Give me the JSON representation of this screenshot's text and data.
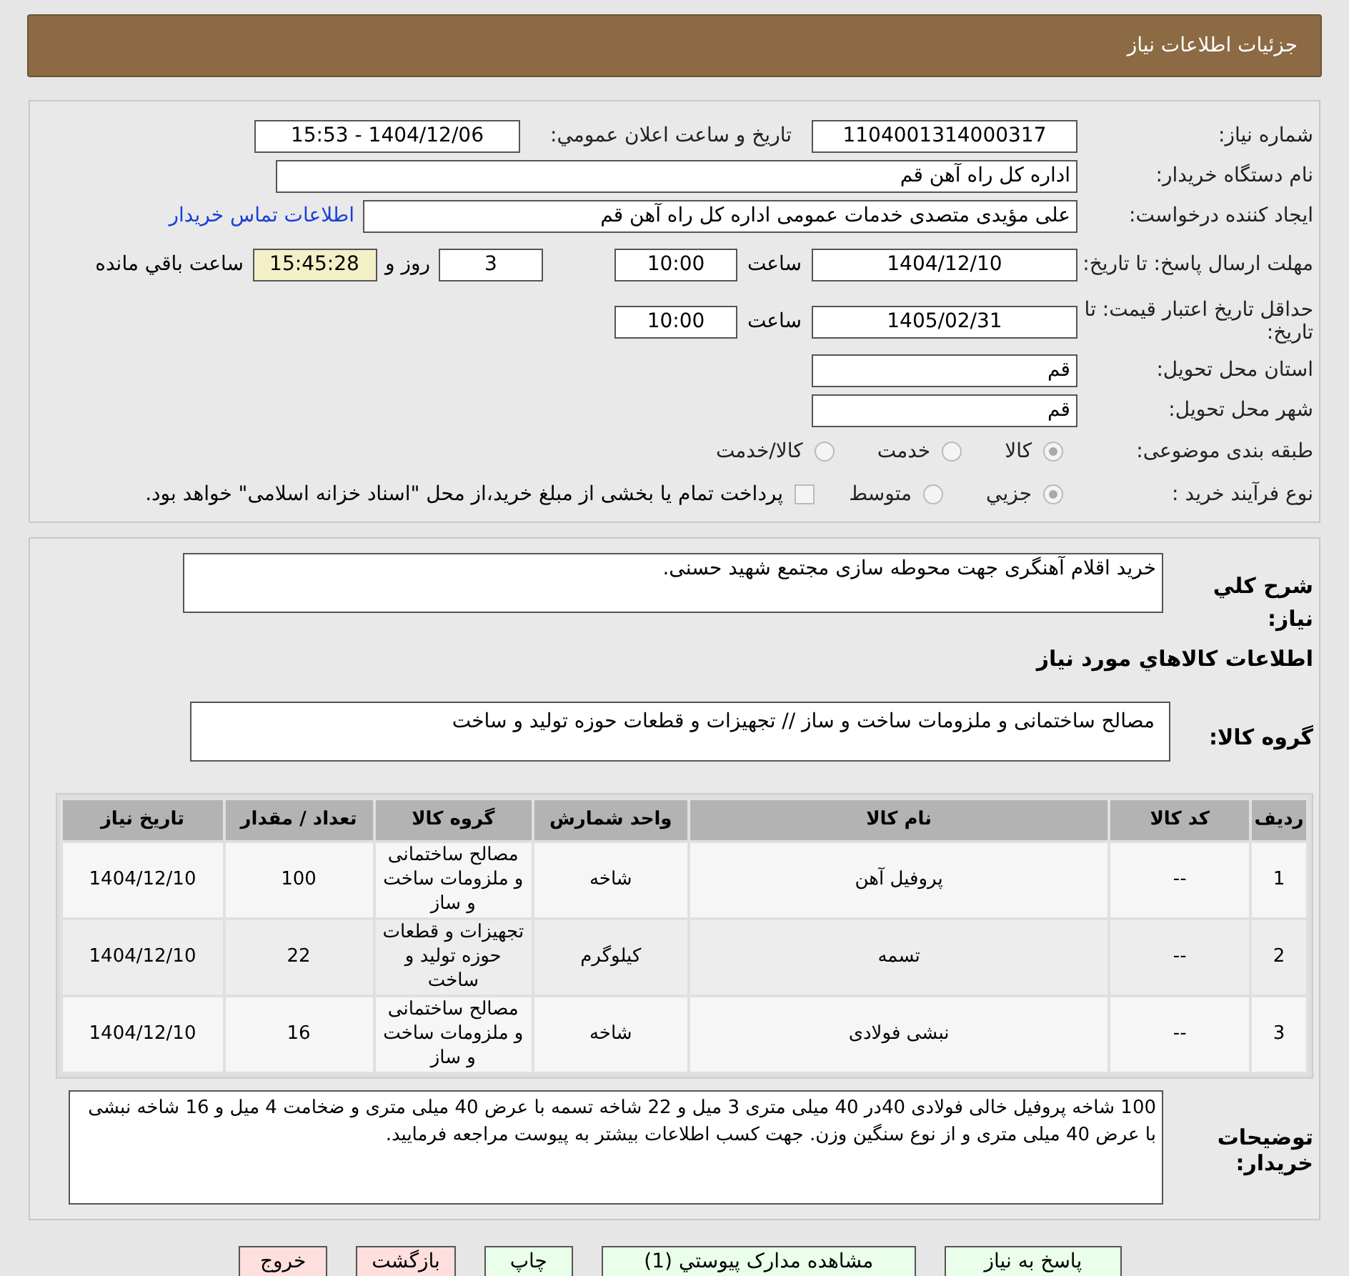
{
  "header": {
    "title": "جزئیات اطلاعات نیاز"
  },
  "need_number": {
    "label": "شماره نیاز:",
    "value": "1104001314000317"
  },
  "announce": {
    "label": "تاریخ و ساعت اعلان عمومي:",
    "value": "1404/12/06 - 15:53"
  },
  "buyer_org": {
    "label": "نام دستگاه خریدار:",
    "value": "اداره کل  راه آهن قم"
  },
  "requester": {
    "label": "ایجاد کننده درخواست:",
    "value": "علی مؤیدی متصدی خدمات عمومی اداره کل  راه آهن قم",
    "link": "اطلاعات تماس خریدار"
  },
  "deadline": {
    "label": "مهلت ارسال پاسخ: تا تاریخ:",
    "date": "1404/12/10",
    "time_label": "ساعت",
    "time": "10:00",
    "days": "3",
    "days_label": "روز و",
    "remaining": "15:45:28",
    "remaining_label": "ساعت باقي مانده"
  },
  "validity": {
    "label": "حداقل تاریخ اعتبار قیمت: تا تاریخ:",
    "date": "1405/02/31",
    "time_label": "ساعت",
    "time": "10:00"
  },
  "province": {
    "label": "استان محل تحویل:",
    "value": "قم"
  },
  "city": {
    "label": "شهر محل تحویل:",
    "value": "قم"
  },
  "category": {
    "label": "طبقه بندی موضوعی:",
    "options": [
      {
        "label": "کالا",
        "selected": true
      },
      {
        "label": "خدمت",
        "selected": false
      },
      {
        "label": "کالا/خدمت",
        "selected": false
      }
    ]
  },
  "process": {
    "label": "نوع فرآیند خرید :",
    "options": [
      {
        "label": "جزيي",
        "selected": true
      },
      {
        "label": "متوسط",
        "selected": false
      }
    ],
    "payment": {
      "label": "پرداخت تمام یا بخشی از مبلغ خرید،از محل \"اسناد خزانه اسلامی\" خواهد بود.",
      "checked": false
    }
  },
  "description": {
    "label": "شرح کلي نیاز:",
    "value": "خرید اقلام آهنگری جهت محوطه سازی مجتمع شهید حسنی."
  },
  "goods_title": "اطلاعات کالاهاي مورد نیاز",
  "goods_group": {
    "label": "گروه کالا:",
    "value": "مصالح ساختمانی و ملزومات ساخت و ساز // تجهیزات و قطعات حوزه تولید و ساخت"
  },
  "table": {
    "columns": [
      "ردیف",
      "کد کالا",
      "نام کالا",
      "واحد شمارش",
      "گروه کالا",
      "تعداد / مقدار",
      "تاریخ نیاز"
    ],
    "rows": [
      [
        "1",
        "--",
        "پروفیل آهن",
        "شاخه",
        "مصالح ساختمانی و ملزومات ساخت و ساز",
        "100",
        "1404/12/10"
      ],
      [
        "2",
        "--",
        "تسمه",
        "کیلوگرم",
        "تجهیزات و قطعات حوزه تولید و ساخت",
        "22",
        "1404/12/10"
      ],
      [
        "3",
        "--",
        "نبشی فولادی",
        "شاخه",
        "مصالح ساختمانی و ملزومات ساخت و ساز",
        "16",
        "1404/12/10"
      ]
    ]
  },
  "buyer_notes": {
    "label": "توضیحات خریدار:",
    "value": "100 شاخه پروفیل خالی فولادی 40در 40 میلی متری 3 میل و 22 شاخه تسمه با عرض 40 میلی متری و ضخامت 4 میل و 16 شاخه نبشی با عرض 40 میلی متری و از نوع سنگین وزن. جهت کسب اطلاعات بیشتر به پیوست مراجعه فرمایید."
  },
  "buttons": [
    {
      "label": "پاسخ به نیاز",
      "kind": "action"
    },
    {
      "label": "مشاهده مدارک پیوستي (1)",
      "kind": "action"
    },
    {
      "label": "چاپ",
      "kind": "action"
    },
    {
      "label": "بازگشت",
      "kind": "exit"
    },
    {
      "label": "خروج",
      "kind": "exit"
    }
  ]
}
